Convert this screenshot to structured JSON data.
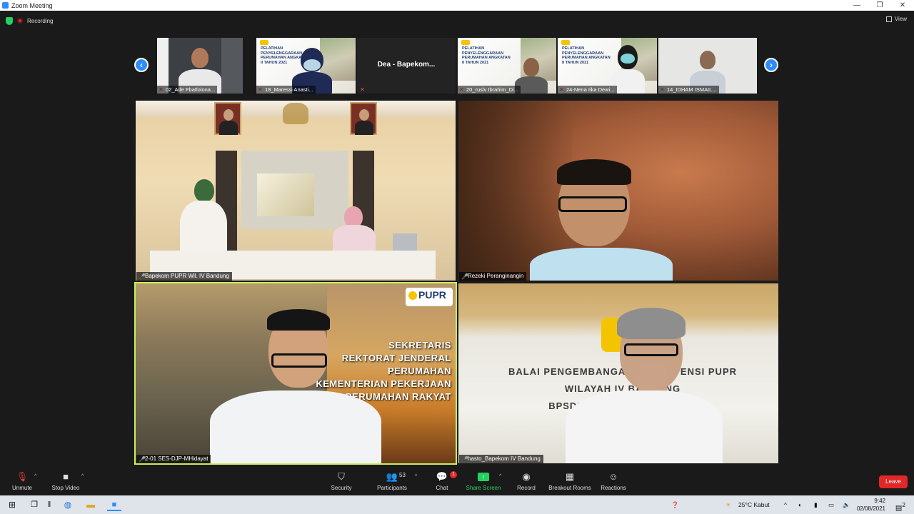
{
  "window": {
    "title": "Zoom Meeting",
    "controls": [
      "—",
      "❐",
      "✕"
    ]
  },
  "meeting_header": {
    "recording_label": "Recording",
    "view_label": "View"
  },
  "strip": {
    "prev_icon": "‹",
    "next_icon": "›",
    "thumbnails": [
      {
        "name": "02_Ade Fbatlolona..."
      },
      {
        "name": "18_Maressi Anasti..."
      },
      {
        "name": "",
        "center_label": "Dea - Bapekom..."
      },
      {
        "name": "20_ruslv Ibrahim_Di..."
      },
      {
        "name": "24-Nena Iika Dewi..."
      },
      {
        "name": "14_IDHAM ISMAIL..."
      }
    ],
    "slide_title": "PELATIHAN PENYELENGGARAAN PERUMAHAN ANGKATAN II TAHUN 2021"
  },
  "tiles": [
    {
      "name": "Bapekom PUPR Wil. IV Bandung"
    },
    {
      "name": "Rezeki Peranginangin"
    },
    {
      "name": "2-01 SES-DJP-MHidayat",
      "badge": "PUPR",
      "slogan": [
        "SEKRETARIS",
        "REKTORAT JENDERAL",
        "PERUMAHAN",
        "KEMENTERIAN PEKERJAAN",
        "UMUM PERUMAHAN RAKYAT"
      ]
    },
    {
      "name": "hasto_Bapekom IV Bandung",
      "wall_text": [
        "BALAI PENGEMBANGAN KOMPETENSI PUPR",
        "WILAYAH IV BANDUNG",
        "BPSDM KEMENTERIAN PUPR"
      ]
    }
  ],
  "toolbar": {
    "unmute": "Unmute",
    "stop_video": "Stop Video",
    "security": "Security",
    "participants": "Participants",
    "participants_count": "53",
    "chat": "Chat",
    "chat_badge": "1",
    "share_screen": "Share Screen",
    "record": "Record",
    "breakout": "Breakout Rooms",
    "reactions": "Reactions",
    "leave": "Leave"
  },
  "taskbar": {
    "weather": "25°C  Kabut",
    "time": "9:42",
    "date": "02/08/2021",
    "notifications": "2"
  },
  "colors": {
    "accent": "#2d8cff",
    "leave": "#e02828",
    "active_speaker": "#c8f05a",
    "share": "#23d160"
  }
}
